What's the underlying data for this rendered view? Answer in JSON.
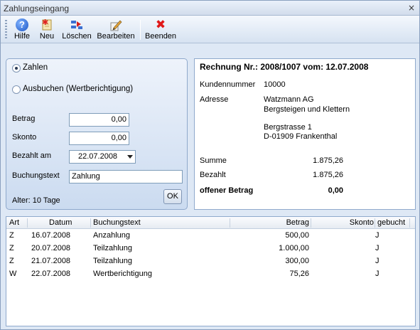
{
  "window": {
    "title": "Zahlungseingang",
    "close_glyph": "×"
  },
  "toolbar": {
    "help_label": "Hilfe",
    "new_label": "Neu",
    "delete_label": "Löschen",
    "edit_label": "Bearbeiten",
    "exit_label": "Beenden",
    "icons": [
      "help-icon",
      "new-document-icon",
      "delete-icon",
      "edit-pencil-icon",
      "exit-x-icon"
    ]
  },
  "form": {
    "radio_pay_label": "Zahlen",
    "radio_writeoff_label": "Ausbuchen (Wertberichtigung)",
    "radio_selected": "pay",
    "amount_label": "Betrag",
    "amount_value": "0,00",
    "discount_label": "Skonto",
    "discount_value": "0,00",
    "paid_on_label": "Bezahlt am",
    "paid_on_value": "22.07.2008",
    "posting_text_label": "Buchungstext",
    "posting_text_value": "Zahlung",
    "age_text": "Alter: 10 Tage",
    "ok_label": "OK"
  },
  "invoice": {
    "heading": "Rechnung Nr.: 2008/1007 vom: 12.07.2008",
    "customer_no_label": "Kundennummer",
    "customer_no_value": "10000",
    "address_label": "Adresse",
    "address_line1": "Watzmann AG",
    "address_line2": "Bergsteigen und Klettern",
    "address_line3": "Bergstrasse 1",
    "address_line4": "D-01909 Frankenthal",
    "sum_label": "Summe",
    "sum_value": "1.875,26",
    "paid_label": "Bezahlt",
    "paid_value": "1.875,26",
    "open_label": "offener Betrag",
    "open_value": "0,00"
  },
  "grid": {
    "columns": [
      "Art",
      "Datum",
      "Buchungstext",
      "Betrag",
      "Skonto",
      "gebucht"
    ],
    "rows": [
      {
        "art": "Z",
        "datum": "16.07.2008",
        "text": "Anzahlung",
        "betrag": "500,00",
        "skonto": "",
        "gebucht": "J"
      },
      {
        "art": "Z",
        "datum": "20.07.2008",
        "text": "Teilzahlung",
        "betrag": "1.000,00",
        "skonto": "",
        "gebucht": "J"
      },
      {
        "art": "Z",
        "datum": "21.07.2008",
        "text": "Teilzahlung",
        "betrag": "300,00",
        "skonto": "",
        "gebucht": "J"
      },
      {
        "art": "W",
        "datum": "22.07.2008",
        "text": "Wertberichtigung",
        "betrag": "75,26",
        "skonto": "",
        "gebucht": "J"
      }
    ]
  },
  "colors": {
    "accent": "#1b55c4",
    "exit": "#e01818",
    "panel_border": "#8fa9cc"
  }
}
